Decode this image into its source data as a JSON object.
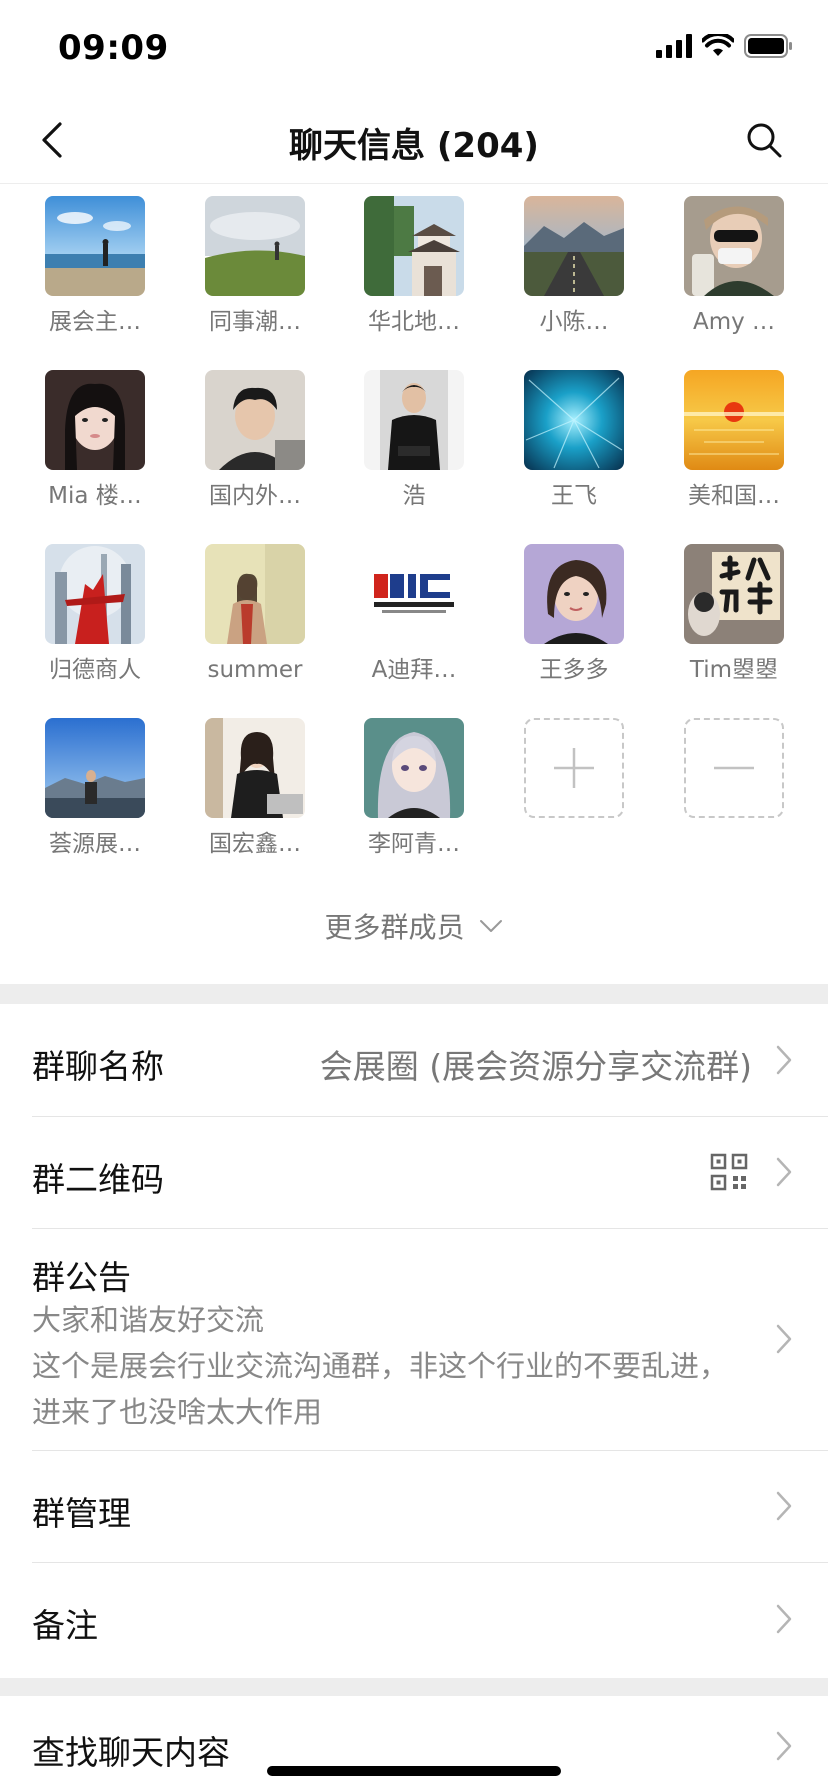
{
  "status_bar": {
    "time": "09:09"
  },
  "nav": {
    "title": "聊天信息 (204)"
  },
  "members": [
    {
      "name": "展会主…"
    },
    {
      "name": "同事潮…"
    },
    {
      "name": "华北地…"
    },
    {
      "name": "小陈…"
    },
    {
      "name": "Amy …"
    },
    {
      "name": "Mia 楼…"
    },
    {
      "name": "国内外…"
    },
    {
      "name": "浩"
    },
    {
      "name": "王飞"
    },
    {
      "name": "美和国…"
    },
    {
      "name": "归德商人"
    },
    {
      "name": "summer"
    },
    {
      "name": "A迪拜…"
    },
    {
      "name": "王多多"
    },
    {
      "name": "Tim曌曌"
    },
    {
      "name": "荟源展…"
    },
    {
      "name": "国宏鑫…"
    },
    {
      "name": "李阿青…"
    }
  ],
  "more_members": "更多群成员",
  "settings": {
    "group_name_label": "群聊名称",
    "group_name_value": "会展圈 (展会资源分享交流群)",
    "qr_label": "群二维码",
    "notice_label": "群公告",
    "notice_lines": [
      "大家和谐友好交流",
      "这个是展会行业交流沟通群，非这个行业的不要乱进，",
      "进来了也没啥太大作用"
    ],
    "manage_label": "群管理",
    "remark_label": "备注",
    "search_label": "查找聊天内容"
  },
  "colors": {
    "background_gap": "#ededed",
    "secondary_text": "#777777"
  }
}
